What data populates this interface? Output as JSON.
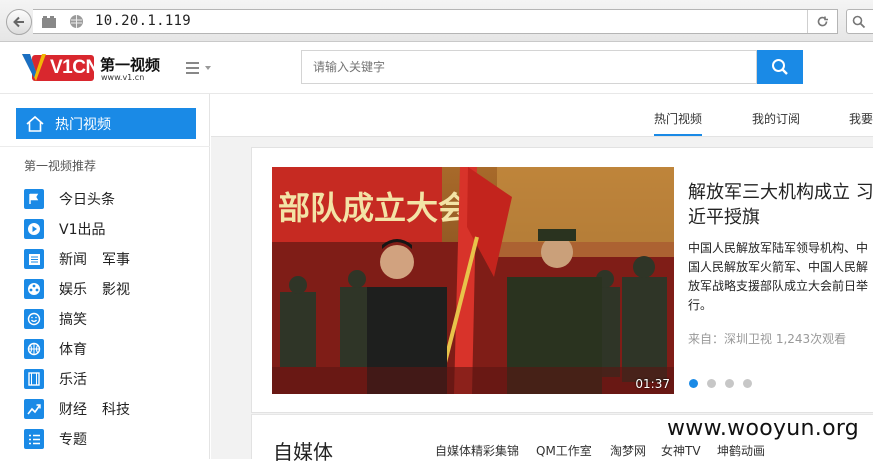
{
  "browser": {
    "url": "10.20.1.119"
  },
  "header": {
    "logo_text": "V1CN",
    "logo_cn": "第一视频",
    "logo_url": "www.v1.cn",
    "search_placeholder": "请输入关键字"
  },
  "sidebar": {
    "active": "热门视频",
    "section_title": "第一视频推荐",
    "items": [
      {
        "label": "今日头条",
        "icon": "flag-icon"
      },
      {
        "label": "V1出品",
        "icon": "play-icon"
      },
      {
        "label": "新闻",
        "label2": "军事",
        "icon": "news-icon"
      },
      {
        "label": "娱乐",
        "label2": "影视",
        "icon": "film-reel-icon"
      },
      {
        "label": "搞笑",
        "icon": "smile-icon"
      },
      {
        "label": "体育",
        "icon": "basketball-icon"
      },
      {
        "label": "乐活",
        "icon": "film-strip-icon"
      },
      {
        "label": "财经",
        "label2": "科技",
        "icon": "trend-icon"
      },
      {
        "label": "专题",
        "icon": "list-icon"
      }
    ]
  },
  "tabs": {
    "hot": "热门视频",
    "subscriptions": "我的订阅",
    "mine": "我要"
  },
  "featured": {
    "banner_text": "部队成立大会",
    "duration": "01:37",
    "headline": "解放军三大机构成立 习近平授旗",
    "summary": "中国人民解放军陆军领导机构、中国人民解放军火箭军、中国人民解放军战略支援部队成立大会前日举行。",
    "meta": "来自：深圳卫视 1,243次观看",
    "slide_count": 4,
    "active_slide": 1
  },
  "lower": {
    "title": "自媒体",
    "subtabs": [
      "自媒体精彩集锦",
      "QM工作室",
      "淘梦网",
      "女神TV",
      "坤鹤动画"
    ]
  },
  "watermark": "www.wooyun.org",
  "colors": {
    "accent": "#1a8ae6",
    "banner_red": "#c62a22"
  }
}
